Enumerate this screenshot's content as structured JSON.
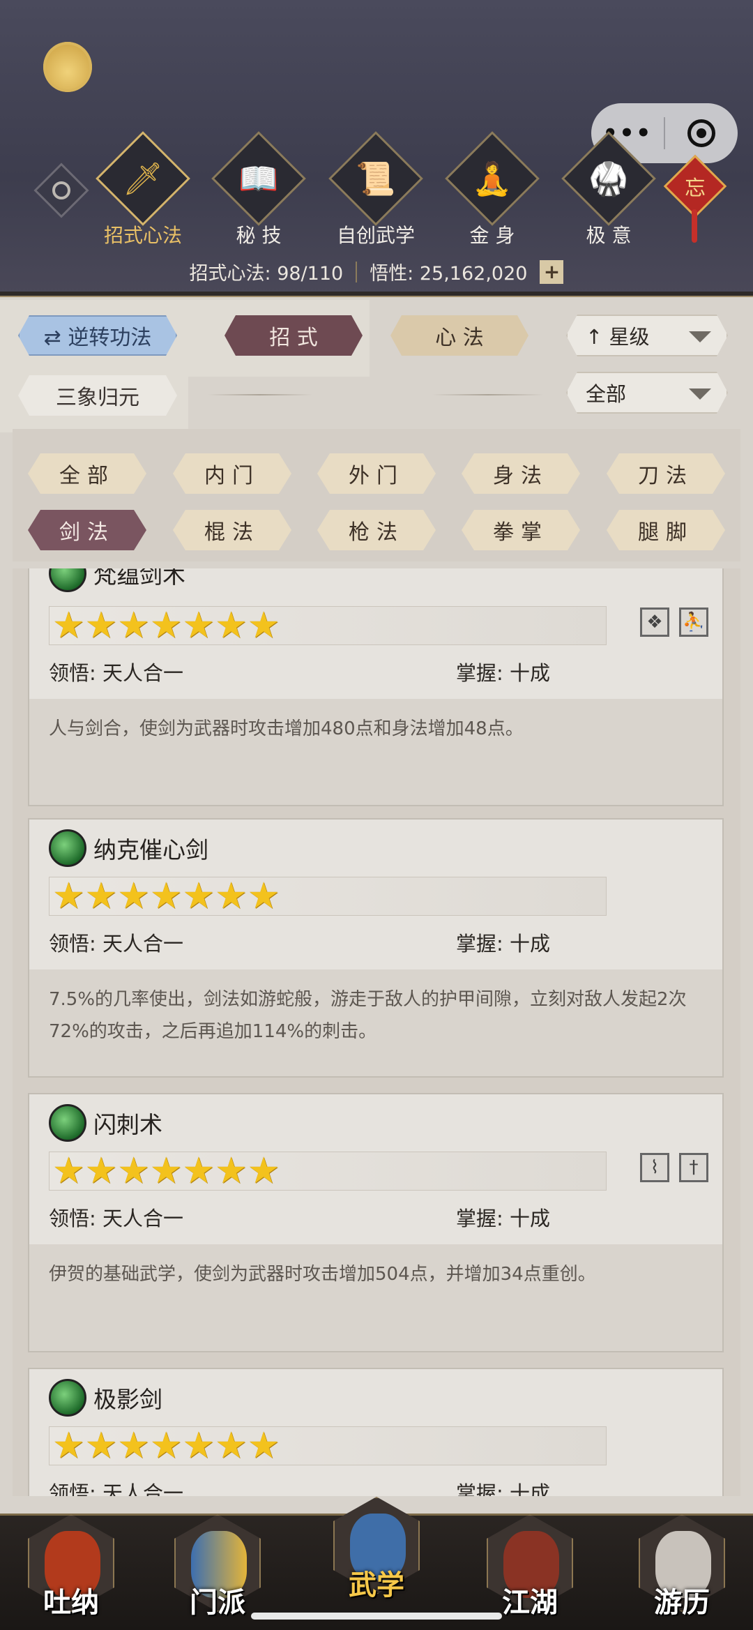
{
  "topnav": [
    {
      "label": "招式心法",
      "icon": "sword-icon",
      "glyph": "🗡"
    },
    {
      "label": "秘 技",
      "icon": "book-icon",
      "glyph": "📖"
    },
    {
      "label": "自创武学",
      "icon": "scroll-icon",
      "glyph": "📜"
    },
    {
      "label": "金 身",
      "icon": "meditate-icon",
      "glyph": "🧘"
    },
    {
      "label": "极 意",
      "icon": "martial-stance-icon",
      "glyph": "🥋"
    }
  ],
  "knot_char": "忘",
  "capsule": {
    "more": "•••"
  },
  "stats": {
    "skill_label": "招式心法: 98/110",
    "insight_label": "悟性: 25,162,020",
    "plus": "+"
  },
  "controls": {
    "reverse": "⇄ 逆转功法",
    "zhaoshi": "招 式",
    "xinfa": "心 法",
    "sort": "↑ 星级",
    "sanxiang": "三象归元",
    "filter_all": "全部"
  },
  "chips": [
    "全部",
    "内门",
    "外门",
    "身法",
    "刀法",
    "剑法",
    "棍法",
    "枪法",
    "拳掌",
    "腿脚"
  ],
  "cards": [
    {
      "name": "梵蕴剑术",
      "stars": "★★★★★★★",
      "insight": "领悟:  天人合一",
      "mastery": "掌握:  十成",
      "desc": "人与剑合，使剑为武器时攻击增加480点和身法增加48点。",
      "tags": [
        "❖",
        "⛹"
      ]
    },
    {
      "name": "纳克催心剑",
      "stars": "★★★★★★★",
      "insight": "领悟:  天人合一",
      "mastery": "掌握:  十成",
      "desc": "7.5%的几率使出，剑法如游蛇般，游走于敌人的护甲间隙，立刻对敌人发起2次72%的攻击，之后再追加114%的刺击。",
      "tags": []
    },
    {
      "name": "闪刺术",
      "stars": "★★★★★★★",
      "insight": "领悟:  天人合一",
      "mastery": "掌握:  十成",
      "desc": "伊贺的基础武学，使剑为武器时攻击增加504点，并增加34点重创。",
      "tags": [
        "⌇",
        "†"
      ]
    },
    {
      "name": "极影剑",
      "stars": "★★★★★★★",
      "insight": "领悟:  天人合一",
      "mastery": "掌握:  十成",
      "desc": "",
      "tags": []
    }
  ],
  "bottomnav": [
    {
      "label": "吐纳",
      "color": "#b23a1c"
    },
    {
      "label": "门派",
      "color": "#3d6fb0"
    },
    {
      "label": "武学",
      "color": "#3f6ea8"
    },
    {
      "label": "江湖",
      "color": "#8a3324"
    },
    {
      "label": "游历",
      "color": "#c8c2bb"
    }
  ]
}
